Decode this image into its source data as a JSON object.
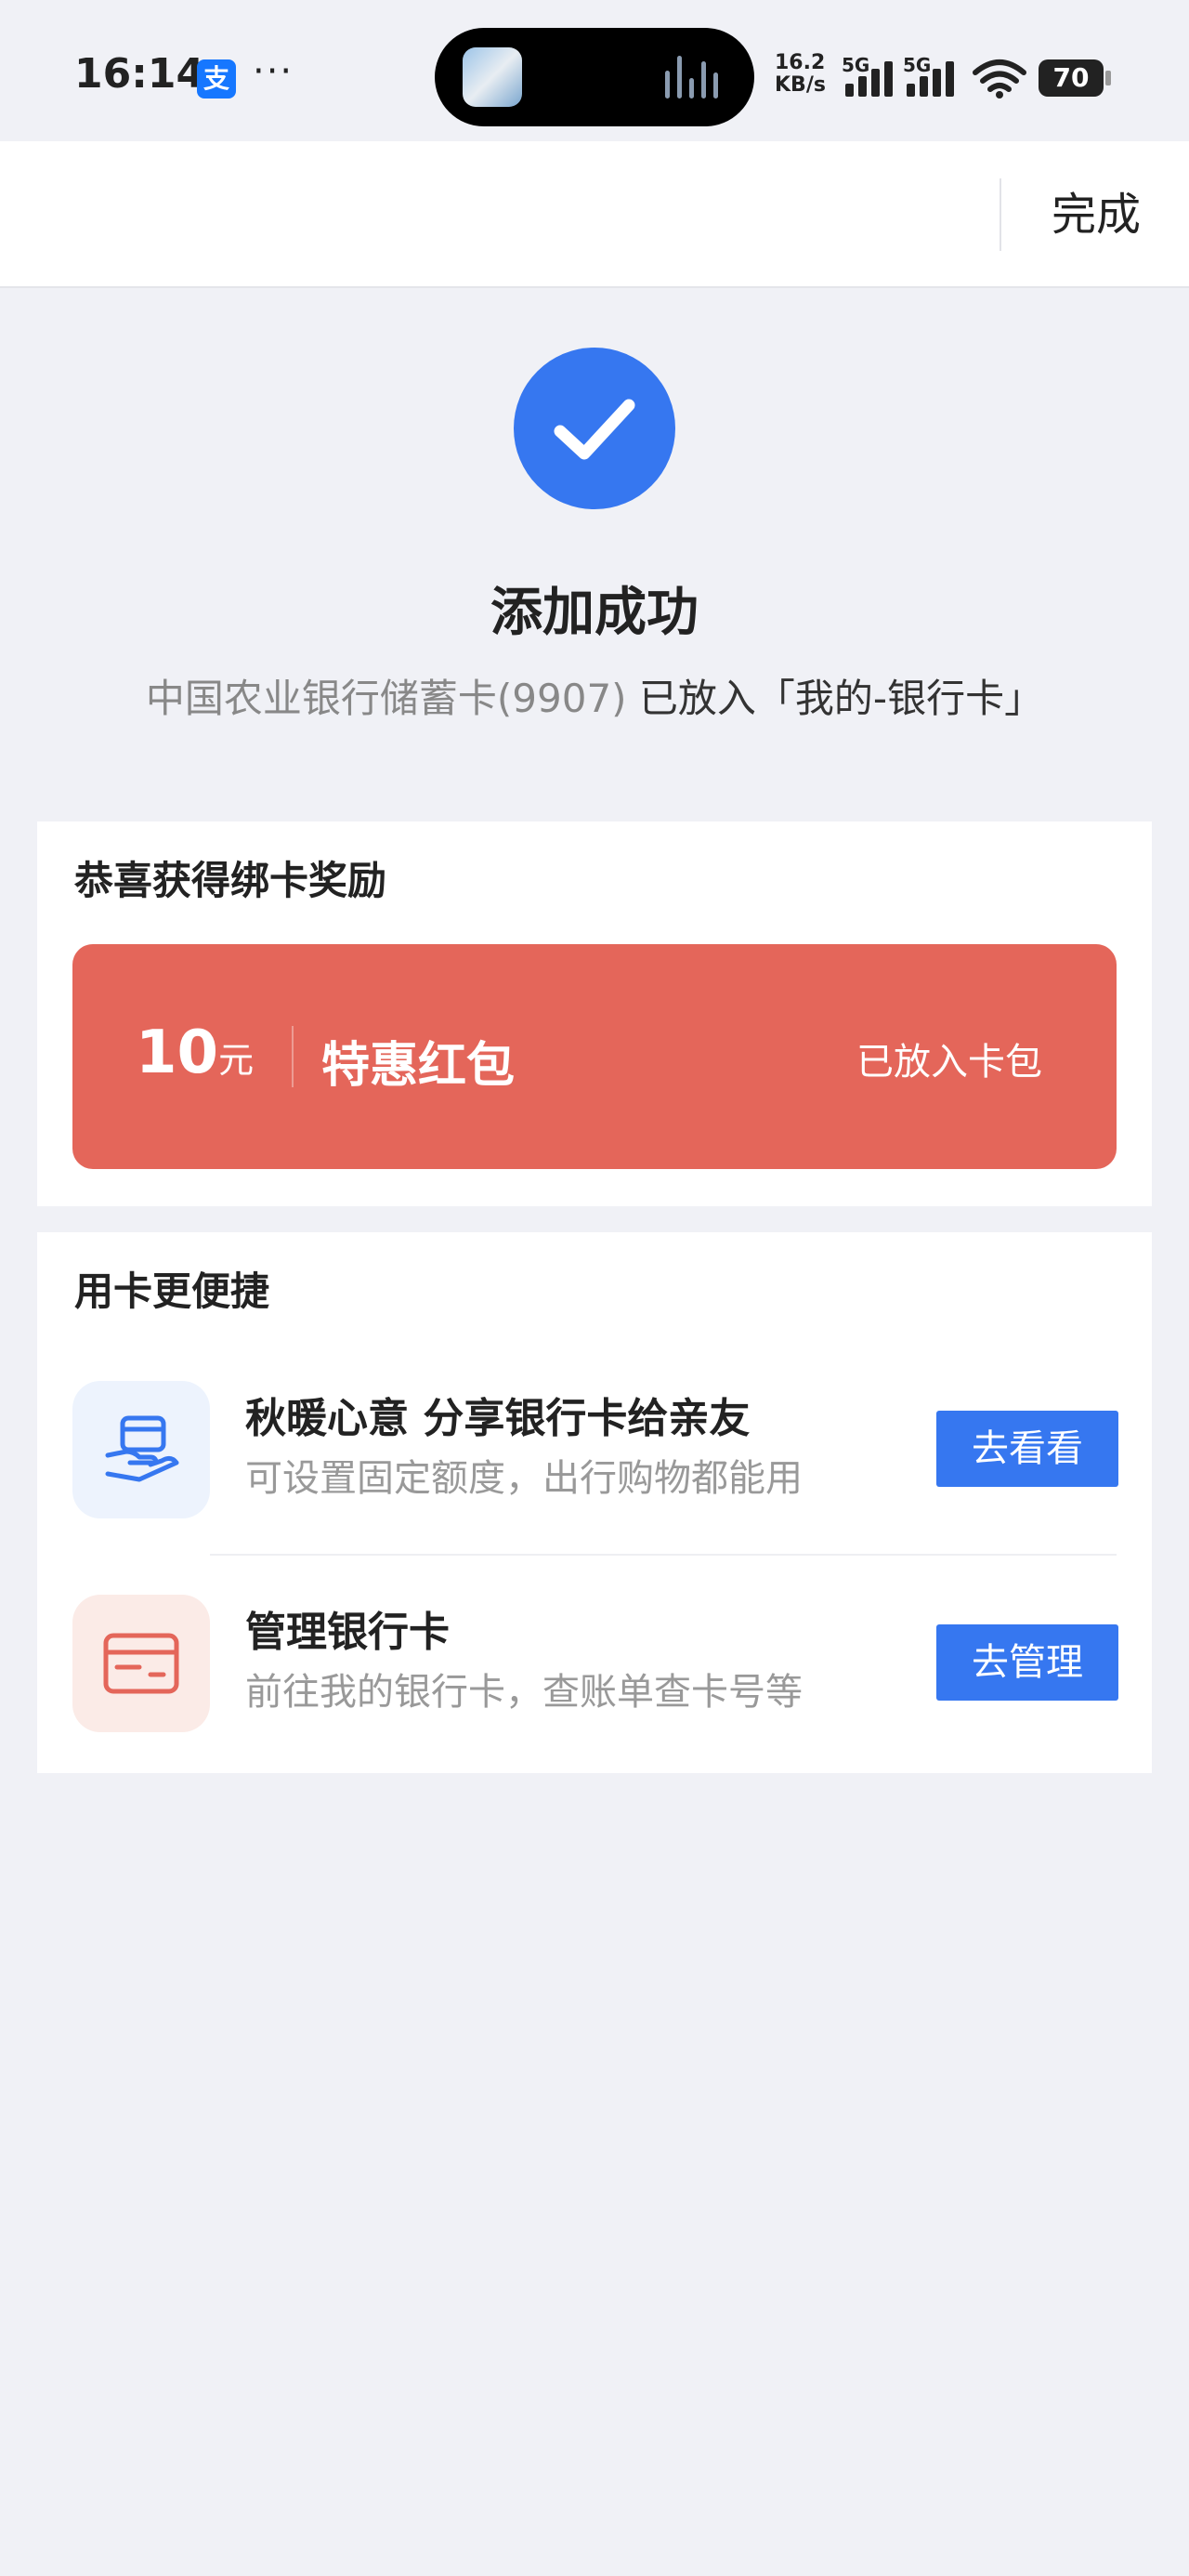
{
  "status_bar": {
    "time": "16:14",
    "alipay_badge": "支",
    "more": "···",
    "net_rate": "16.2",
    "net_unit": "KB/s",
    "signal_1_label": "5G",
    "signal_2_label": "5G",
    "battery": "70"
  },
  "header": {
    "done_label": "完成"
  },
  "success": {
    "icon": "check-icon",
    "title": "添加成功",
    "subtitle_gray": "中国农业银行储蓄卡(9907)",
    "subtitle_dark": " 已放入「我的-银行卡」"
  },
  "reward": {
    "title": "恭喜获得绑卡奖励",
    "amount": "10",
    "amount_unit": "元",
    "name": "特惠红包",
    "status": "已放入卡包",
    "banner_color": "#e4665a"
  },
  "convenience": {
    "title": "用卡更便捷",
    "items": [
      {
        "icon": "hand-card-icon",
        "title": "秋暖心意 分享银行卡给亲友",
        "desc": "可设置固定额度，出行购物都能用",
        "button": "去看看"
      },
      {
        "icon": "bank-card-icon",
        "title": "管理银行卡",
        "desc": "前往我的银行卡，查账单查卡号等",
        "button": "去管理"
      }
    ]
  },
  "colors": {
    "accent": "#3677f0",
    "background": "#f0f1f6"
  }
}
